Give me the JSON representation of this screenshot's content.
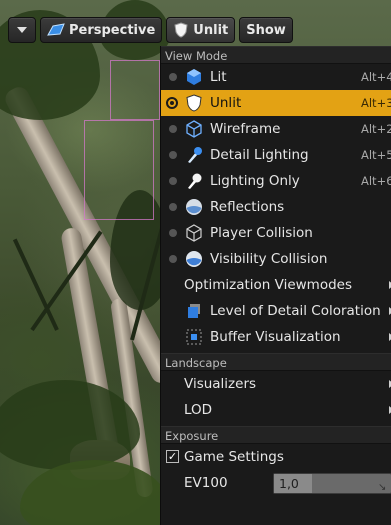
{
  "toolbar": {
    "viewport_options_icon": "chevron-down-icon",
    "perspective_label": "Perspective",
    "view_mode_label": "Unlit",
    "show_label": "Show"
  },
  "menu": {
    "view_mode_header": "View Mode",
    "view_modes": [
      {
        "label": "Lit",
        "shortcut": "Alt+4",
        "icon": "lit-sphere-icon",
        "selected": false
      },
      {
        "label": "Unlit",
        "shortcut": "Alt+3",
        "icon": "unlit-shield-icon",
        "selected": true
      },
      {
        "label": "Wireframe",
        "shortcut": "Alt+2",
        "icon": "wireframe-cube-icon",
        "selected": false
      },
      {
        "label": "Detail Lighting",
        "shortcut": "Alt+5",
        "icon": "detail-lighting-icon",
        "selected": false
      },
      {
        "label": "Lighting Only",
        "shortcut": "Alt+6",
        "icon": "lighting-only-icon",
        "selected": false
      },
      {
        "label": "Reflections",
        "shortcut": "",
        "icon": "reflections-sphere-icon",
        "selected": false
      },
      {
        "label": "Player Collision",
        "shortcut": "",
        "icon": "player-collision-icon",
        "selected": false
      },
      {
        "label": "Visibility Collision",
        "shortcut": "",
        "icon": "visibility-collision-icon",
        "selected": false
      }
    ],
    "optimization_viewmodes": "Optimization Viewmodes",
    "level_of_detail": "Level of Detail Coloration",
    "buffer_visualization": "Buffer Visualization",
    "landscape_header": "Landscape",
    "visualizers": "Visualizers",
    "lod": "LOD",
    "exposure_header": "Exposure",
    "game_settings": {
      "label": "Game Settings",
      "checked": true,
      "check_glyph": "✓"
    },
    "ev100": {
      "label": "EV100",
      "value": "1,0",
      "grip_glyph": "↘"
    }
  },
  "colors": {
    "selected_highlight": "#e3a214",
    "menu_background": "#1a1a1a"
  }
}
